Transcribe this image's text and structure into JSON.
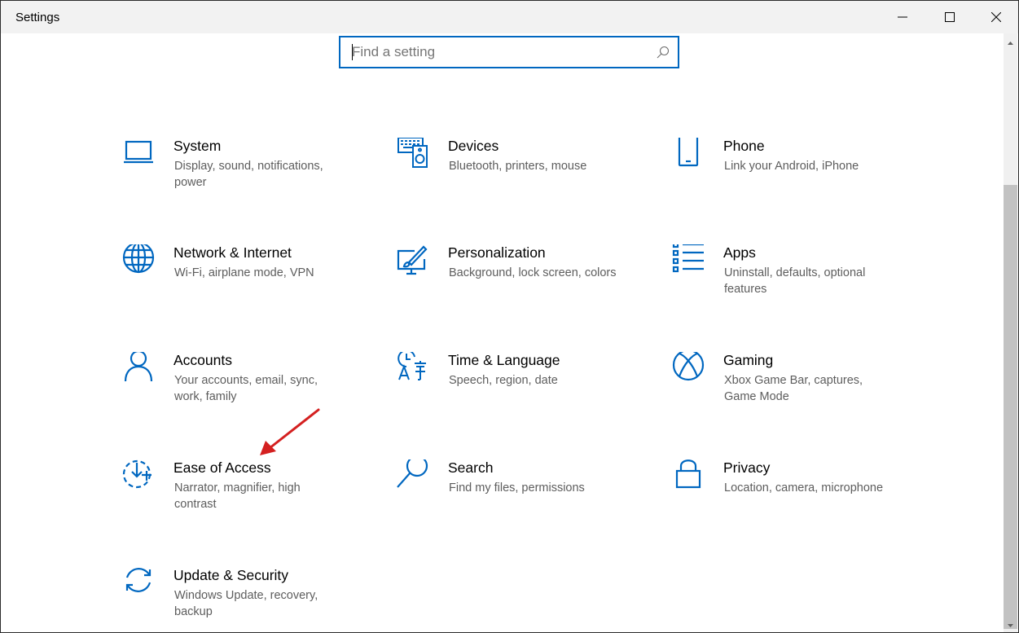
{
  "window": {
    "title": "Settings"
  },
  "search": {
    "placeholder": "Find a setting",
    "value": ""
  },
  "tiles": [
    {
      "name": "System",
      "desc": "Display, sound, notifications, power",
      "icon": "laptop-icon"
    },
    {
      "name": "Devices",
      "desc": "Bluetooth, printers, mouse",
      "icon": "devices-icon"
    },
    {
      "name": "Phone",
      "desc": "Link your Android, iPhone",
      "icon": "phone-icon"
    },
    {
      "name": "Network & Internet",
      "desc": "Wi-Fi, airplane mode, VPN",
      "icon": "globe-icon"
    },
    {
      "name": "Personalization",
      "desc": "Background, lock screen, colors",
      "icon": "paintbrush-icon"
    },
    {
      "name": "Apps",
      "desc": "Uninstall, defaults, optional features",
      "icon": "apps-list-icon"
    },
    {
      "name": "Accounts",
      "desc": "Your accounts, email, sync, work, family",
      "icon": "person-icon"
    },
    {
      "name": "Time & Language",
      "desc": "Speech, region, date",
      "icon": "time-language-icon"
    },
    {
      "name": "Gaming",
      "desc": "Xbox Game Bar, captures, Game Mode",
      "icon": "xbox-icon"
    },
    {
      "name": "Ease of Access",
      "desc": "Narrator, magnifier, high contrast",
      "icon": "ease-of-access-icon"
    },
    {
      "name": "Search",
      "desc": "Find my files, permissions",
      "icon": "magnifier-icon"
    },
    {
      "name": "Privacy",
      "desc": "Location, camera, microphone",
      "icon": "lock-icon"
    },
    {
      "name": "Update & Security",
      "desc": "Windows Update, recovery, backup",
      "icon": "sync-icon"
    }
  ],
  "colors": {
    "accent": "#0067c0",
    "annotation": "#d42020",
    "title_bar": "#f2f2f2"
  }
}
